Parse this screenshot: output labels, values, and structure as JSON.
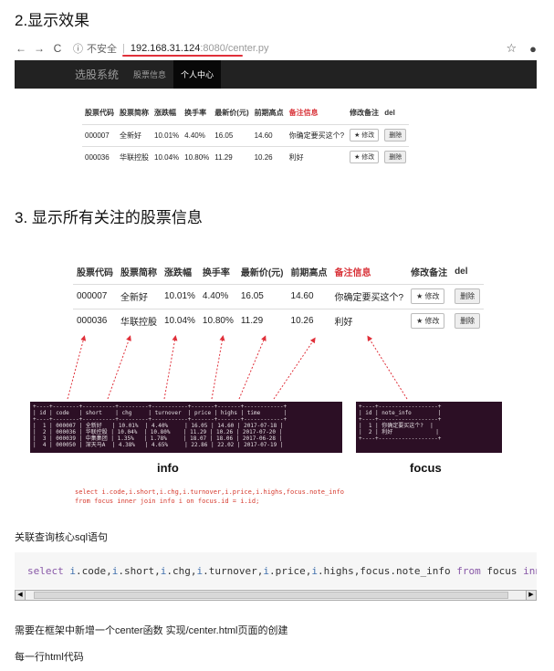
{
  "headings": {
    "section2": "2.显示效果",
    "section3": "3. 显示所有关注的股票信息"
  },
  "browser": {
    "back": "←",
    "forward": "→",
    "reload": "C",
    "info_icon": "ⓘ",
    "insecure": "不安全",
    "url_host": "192.168.31.124",
    "url_path": ":8080/center.py",
    "bookmark_icon": "☆",
    "account_icon": "●"
  },
  "navbar": {
    "brand": "选股系统",
    "items": [
      "股票信息",
      "个人中心"
    ],
    "active_index": 1
  },
  "stock_table": {
    "headers": [
      "股票代码",
      "股票简称",
      "涨跌幅",
      "换手率",
      "最新价(元)",
      "前期高点",
      "备注信息",
      "修改备注",
      "del"
    ],
    "rows": [
      [
        "000007",
        "全新好",
        "10.01%",
        "4.40%",
        "16.05",
        "14.60",
        "你确定要买这个?"
      ],
      [
        "000036",
        "华联控股",
        "10.04%",
        "10.80%",
        "11.29",
        "10.26",
        "利好"
      ]
    ],
    "edit_label": "★ 修改",
    "delete_label": "删除"
  },
  "terminal_info": {
    "lines": [
      "+----+--------+----------+---------+-----------+-------+-------+------------+",
      "| id | code   | short    | chg     | turnover  | price | highs | time       |",
      "+----+--------+----------+---------+-----------+-------+-------+------------+",
      "|  1 | 000007 | 全新好   | 10.01%  | 4.40%     | 16.05 | 14.60 | 2017-07-18 |",
      "|  2 | 000036 | 华联控股 | 10.04%  | 10.80%    | 11.29 | 10.26 | 2017-07-20 |",
      "|  3 | 000039 | 中集集团 | 1.35%   | 1.78%     | 18.07 | 18.06 | 2017-06-28 |",
      "|  4 | 000050 | 深天马A  | 4.38%   | 4.65%     | 22.86 | 22.02 | 2017-07-19 |"
    ]
  },
  "terminal_focus": {
    "lines": [
      "+----+------------------+",
      "| id | note_info        |",
      "+----+------------------+",
      "|  1 | 你确定要买这个?  |",
      "|  2 | 利好             |",
      "+----+------------------+"
    ]
  },
  "labels": {
    "info": "info",
    "focus": "focus"
  },
  "sql_red": {
    "line1": "select i.code,i.short,i.chg,i.turnover,i.price,i.highs,focus.note_info",
    "line2": "from focus inner join info i on focus.id = i.id;"
  },
  "paragraphs": {
    "core": "关联查询核心sql语句",
    "center": "需要在框架中新增一个center函数 实现/center.html页面的创建",
    "row": "每一行html代码"
  },
  "code": {
    "tokens": [
      {
        "t": "select",
        "c": "kw"
      },
      {
        "t": " ",
        "c": ""
      },
      {
        "t": "i",
        "c": "alias"
      },
      {
        "t": ".code,",
        "c": ""
      },
      {
        "t": "i",
        "c": "alias"
      },
      {
        "t": ".short,",
        "c": ""
      },
      {
        "t": "i",
        "c": "alias"
      },
      {
        "t": ".chg,",
        "c": ""
      },
      {
        "t": "i",
        "c": "alias"
      },
      {
        "t": ".turnover,",
        "c": ""
      },
      {
        "t": "i",
        "c": "alias"
      },
      {
        "t": ".price,",
        "c": ""
      },
      {
        "t": "i",
        "c": "alias"
      },
      {
        "t": ".highs,focus.note_info ",
        "c": ""
      },
      {
        "t": "from",
        "c": "kw"
      },
      {
        "t": " focus ",
        "c": ""
      },
      {
        "t": "inner",
        "c": "kw"
      }
    ]
  },
  "scrollbar": {
    "left_arrow": "◀",
    "right_arrow": "▶"
  },
  "colors": {
    "note_header": "#d9343a",
    "url_underline": "#e0303a",
    "arrow": "#e0303a",
    "terminal_bg": "#2c0f25"
  }
}
